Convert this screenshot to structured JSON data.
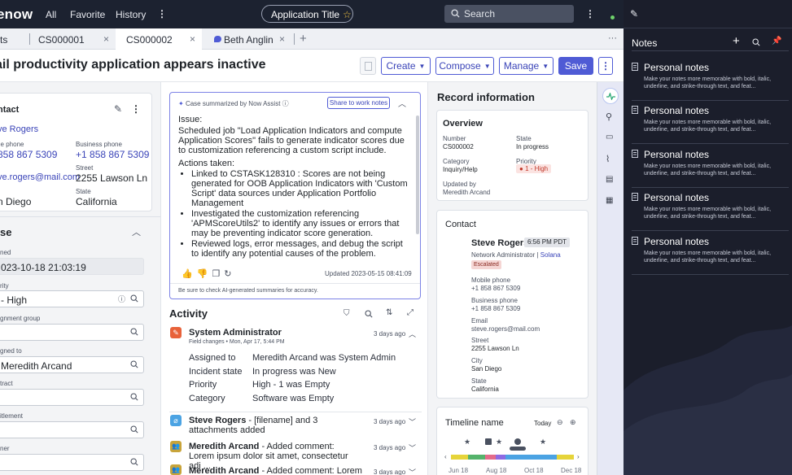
{
  "topnav": {
    "logo": "enow",
    "items": [
      "All",
      "Favorite",
      "History"
    ],
    "app_title": "Application Title",
    "search_placeholder": "Search"
  },
  "tabs": [
    {
      "label": "ts"
    },
    {
      "label": "CS000001"
    },
    {
      "label": "CS000002"
    },
    {
      "label": "Beth Anglin"
    }
  ],
  "tab_overflow": "···",
  "page_title": "ail productivity application appears inactive",
  "toolbar": {
    "create": "Create",
    "compose": "Compose",
    "manage": "Manage",
    "save": "Save"
  },
  "contact_card": {
    "header": "ntact",
    "name": "ve Rogers",
    "mobile_label": "ile phone",
    "mobile": "858 867 5309",
    "business_label": "Business phone",
    "business": "+1 858 867 5309",
    "email_label": "il",
    "email": "ve.rogers@mail.com",
    "street_label": "Street",
    "street": "2255 Lawson Ln",
    "city": "n Diego",
    "state_label": "State",
    "state": "California"
  },
  "case_form": {
    "header": "se",
    "opened_label": "ned",
    "opened": "023-10-18 21:03:19",
    "priority_label": "rity",
    "priority": "- High",
    "assignment_group_label": "gnment group",
    "assigned_to_label": "gned to",
    "assigned_to": "Meredith Arcand",
    "contract_label": "tract",
    "entitlement_label": "itlement",
    "owner_label": "ner"
  },
  "now_assist": {
    "header": "Case summarized by Now Assist",
    "share_button": "Share to work notes",
    "issue_label": "Issue:",
    "issue_text": "Scheduled job \"Load Application Indicators and compute Application Scores\" fails to generate indicator scores due to customization referencing a custom script include.",
    "actions_label": "Actions taken:",
    "actions": [
      "Linked to CSTASK128310 : Scores are not being generated for OOB Application Indicators with  'Custom Script' data sources under Application Portfolio Management",
      "Investigated the customization referencing 'APMScoreUtils2' to identify any issues or errors that may be preventing indicator score generation.",
      "Reviewed logs, error messages, and debug the script to identify any potential causes of the problem."
    ],
    "updated": "Updated 2023-05-15 08:41:09",
    "disclaimer": "Be sure to check AI-generated summaries for accuracy."
  },
  "activity": {
    "header": "Activity",
    "items": [
      {
        "author": "System Administrator",
        "meta": "Field changes  •  Mon, Apr 17, 5:44 PM",
        "time": "3 days ago",
        "changes": [
          {
            "field": "Assigned to",
            "value": "Meredith Arcand was System Admin"
          },
          {
            "field": "Incident state",
            "value": "In progress was New"
          },
          {
            "field": "Priority",
            "value": "High - 1 was Empty"
          },
          {
            "field": "Category",
            "value": "Software was Empty"
          }
        ]
      },
      {
        "author": "Steve Rogers",
        "text": " - [filename] and 3 attachments added",
        "time": "3 days ago"
      },
      {
        "author": "Meredith Arcand",
        "text": " - Added comment: Lorem ipsum dolor sit amet, consectetur adi ...",
        "time": "3 days ago"
      },
      {
        "author": "Meredith Arcand",
        "text": " - Added comment: Lorem",
        "time": "3 days ago"
      }
    ]
  },
  "record_info": {
    "header": "Record information",
    "overview": {
      "title": "Overview",
      "number_label": "Number",
      "number": "CS000002",
      "state_label": "State",
      "state": "In progress",
      "category_label": "Category",
      "category": "Inquiry/Help",
      "priority_label": "Priority",
      "priority": "1 - High",
      "updated_by_label": "Updated by",
      "updated_by": "Meredith Arcand"
    },
    "contact": {
      "title": "Contact",
      "name": "Steve Rogers",
      "time": "6:56 PM PDT",
      "role": "Network Administrator",
      "company": "Solana",
      "badge": "Escalated",
      "mobile_label": "Mobile phone",
      "mobile": "+1 858 867 5309",
      "business_label": "Business phone",
      "business": "+1 858 867 5309",
      "email_label": "Email",
      "email": "steve.rogers@mail.com",
      "street_label": "Street",
      "street": "2255 Lawson Ln",
      "city_label": "City",
      "city": "San Diego",
      "state_label": "State",
      "state": "California"
    },
    "timeline": {
      "title": "Timeline name",
      "today": "Today",
      "labels": [
        "Jun 18",
        "Aug 18",
        "Oct 18",
        "Dec 18"
      ]
    }
  },
  "notes": {
    "header": "Notes",
    "items": [
      {
        "title": "Personal notes",
        "desc": "Make your notes more memorable with bold, italic, underline, and strike-through text, and feat..."
      },
      {
        "title": "Personal notes",
        "desc": "Make your notes more memorable with bold, italic, underline, and strike-through text, and feat..."
      },
      {
        "title": "Personal notes",
        "desc": "Make your notes more memorable with bold, italic, underline, and strike-through text, and feat..."
      },
      {
        "title": "Personal notes",
        "desc": "Make your notes more memorable with bold, italic, underline, and strike-through text, and feat..."
      },
      {
        "title": "Personal notes",
        "desc": "Make your notes more memorable with bold, italic, underline, and strike-through text, and feat..."
      }
    ]
  },
  "colors": {
    "accent": "#4f5bd5",
    "nav_bg": "#1c2230",
    "notes_bg": "#1b1e2b",
    "priority_high": "#c0392b"
  }
}
